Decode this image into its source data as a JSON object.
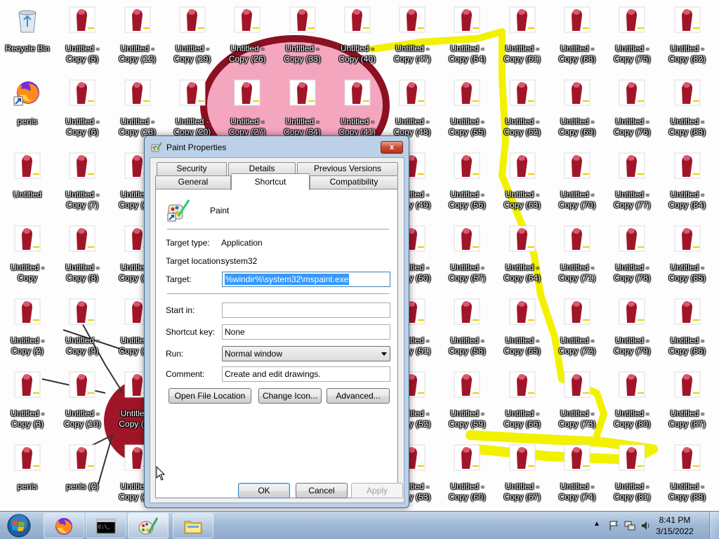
{
  "desktop": {
    "icons": [
      {
        "label": "Recycle Bin",
        "kind": "recycle"
      },
      {
        "label": "Untitled - Copy (5)",
        "kind": "paint"
      },
      {
        "label": "Untitled - Copy (12)",
        "kind": "paint"
      },
      {
        "label": "Untitled - Copy (19)",
        "kind": "paint"
      },
      {
        "label": "Untitled - Copy (26)",
        "kind": "paint"
      },
      {
        "label": "Untitled - Copy (33)",
        "kind": "paint"
      },
      {
        "label": "Untitled - Copy (40)",
        "kind": "paint"
      },
      {
        "label": "Untitled - Copy (47)",
        "kind": "paint"
      },
      {
        "label": "Untitled - Copy (54)",
        "kind": "paint"
      },
      {
        "label": "Untitled - Copy (61)",
        "kind": "paint"
      },
      {
        "label": "Untitled - Copy (68)",
        "kind": "paint"
      },
      {
        "label": "Untitled - Copy (75)",
        "kind": "paint"
      },
      {
        "label": "Untitled - Copy (82)",
        "kind": "paint"
      },
      {
        "label": "penis",
        "kind": "firefox-shortcut"
      },
      {
        "label": "Untitled - Copy (6)",
        "kind": "paint"
      },
      {
        "label": "Untitled - Copy (13)",
        "kind": "paint"
      },
      {
        "label": "Untitled - Copy (20)",
        "kind": "paint"
      },
      {
        "label": "Untitled - Copy (27)",
        "kind": "paint"
      },
      {
        "label": "Untitled - Copy (34)",
        "kind": "paint"
      },
      {
        "label": "Untitled - Copy (41)",
        "kind": "paint"
      },
      {
        "label": "Untitled - Copy (48)",
        "kind": "paint"
      },
      {
        "label": "Untitled - Copy (55)",
        "kind": "paint"
      },
      {
        "label": "Untitled - Copy (62)",
        "kind": "paint"
      },
      {
        "label": "Untitled - Copy (69)",
        "kind": "paint"
      },
      {
        "label": "Untitled - Copy (76)",
        "kind": "paint"
      },
      {
        "label": "Untitled - Copy (83)",
        "kind": "paint"
      },
      {
        "label": "Untitled",
        "kind": "paint"
      },
      {
        "label": "Untitled - Copy (7)",
        "kind": "paint"
      },
      {
        "label": "Untitled - Copy (14)",
        "kind": "paint"
      },
      {
        "label": "",
        "kind": "hidden"
      },
      {
        "label": "",
        "kind": "hidden"
      },
      {
        "label": "",
        "kind": "hidden"
      },
      {
        "label": "",
        "kind": "hidden"
      },
      {
        "label": "Untitled - Copy (49)",
        "kind": "paint"
      },
      {
        "label": "Untitled - Copy (56)",
        "kind": "paint"
      },
      {
        "label": "Untitled - Copy (63)",
        "kind": "paint"
      },
      {
        "label": "Untitled - Copy (70)",
        "kind": "paint"
      },
      {
        "label": "Untitled - Copy (77)",
        "kind": "paint"
      },
      {
        "label": "Untitled - Copy (84)",
        "kind": "paint"
      },
      {
        "label": "Untitled - Copy",
        "kind": "paint"
      },
      {
        "label": "Untitled - Copy (8)",
        "kind": "paint"
      },
      {
        "label": "Untitled - Copy (15)",
        "kind": "paint"
      },
      {
        "label": "",
        "kind": "hidden"
      },
      {
        "label": "",
        "kind": "hidden"
      },
      {
        "label": "",
        "kind": "hidden"
      },
      {
        "label": "",
        "kind": "hidden"
      },
      {
        "label": "Untitled - Copy (50)",
        "kind": "paint"
      },
      {
        "label": "Untitled - Copy (57)",
        "kind": "paint"
      },
      {
        "label": "Untitled - Copy (64)",
        "kind": "paint"
      },
      {
        "label": "Untitled - Copy (71)",
        "kind": "paint"
      },
      {
        "label": "Untitled - Copy (78)",
        "kind": "paint"
      },
      {
        "label": "Untitled - Copy (85)",
        "kind": "paint"
      },
      {
        "label": "Untitled - Copy (2)",
        "kind": "paint"
      },
      {
        "label": "Untitled - Copy (9)",
        "kind": "paint"
      },
      {
        "label": "Untitled - Copy (16)",
        "kind": "paint"
      },
      {
        "label": "",
        "kind": "hidden"
      },
      {
        "label": "",
        "kind": "hidden"
      },
      {
        "label": "",
        "kind": "hidden"
      },
      {
        "label": "",
        "kind": "hidden"
      },
      {
        "label": "Untitled - Copy (51)",
        "kind": "paint"
      },
      {
        "label": "Untitled - Copy (58)",
        "kind": "paint"
      },
      {
        "label": "Untitled - Copy (65)",
        "kind": "paint"
      },
      {
        "label": "Untitled - Copy (72)",
        "kind": "paint"
      },
      {
        "label": "Untitled - Copy (79)",
        "kind": "paint"
      },
      {
        "label": "Untitled - Copy (86)",
        "kind": "paint"
      },
      {
        "label": "Untitled - Copy (3)",
        "kind": "paint"
      },
      {
        "label": "Untitled - Copy (10)",
        "kind": "paint"
      },
      {
        "label": "Untitled - Copy (17)",
        "kind": "paint"
      },
      {
        "label": "",
        "kind": "hidden"
      },
      {
        "label": "",
        "kind": "hidden"
      },
      {
        "label": "",
        "kind": "hidden"
      },
      {
        "label": "",
        "kind": "hidden"
      },
      {
        "label": "Untitled - Copy (52)",
        "kind": "paint"
      },
      {
        "label": "Untitled - Copy (59)",
        "kind": "paint"
      },
      {
        "label": "Untitled - Copy (66)",
        "kind": "paint"
      },
      {
        "label": "Untitled - Copy (73)",
        "kind": "paint"
      },
      {
        "label": "Untitled - Copy (80)",
        "kind": "paint"
      },
      {
        "label": "Untitled - Copy (87)",
        "kind": "paint"
      },
      {
        "label": "penis",
        "kind": "paint"
      },
      {
        "label": "penis (2)",
        "kind": "paint"
      },
      {
        "label": "Untitled - Copy (18)",
        "kind": "paint"
      },
      {
        "label": "",
        "kind": "hidden"
      },
      {
        "label": "",
        "kind": "hidden"
      },
      {
        "label": "",
        "kind": "hidden"
      },
      {
        "label": "",
        "kind": "hidden"
      },
      {
        "label": "Untitled - Copy (53)",
        "kind": "paint"
      },
      {
        "label": "Untitled - Copy (60)",
        "kind": "paint"
      },
      {
        "label": "Untitled - Copy (67)",
        "kind": "paint"
      },
      {
        "label": "Untitled - Copy (74)",
        "kind": "paint"
      },
      {
        "label": "Untitled - Copy (81)",
        "kind": "paint"
      },
      {
        "label": "Untitled - Copy (88)",
        "kind": "paint"
      }
    ]
  },
  "dialog": {
    "title": "Paint Properties",
    "close_label": "x",
    "tabs_back": [
      "Security",
      "Details",
      "Previous Versions"
    ],
    "tabs_front": [
      "General",
      "Shortcut",
      "Compatibility"
    ],
    "active_tab": "Shortcut",
    "app_name": "Paint",
    "target_type_label": "Target type:",
    "target_type_value": "Application",
    "target_location_label": "Target location:",
    "target_location_value": "system32",
    "target_label": "Target:",
    "target_value": "%windir%\\system32\\mspaint.exe",
    "start_in_label": "Start in:",
    "start_in_value": "",
    "shortcut_key_label": "Shortcut key:",
    "shortcut_key_value": "None",
    "run_label": "Run:",
    "run_value": "Normal window",
    "comment_label": "Comment:",
    "comment_value": "Create and edit drawings.",
    "open_file_location": "Open File Location",
    "change_icon": "Change Icon...",
    "advanced": "Advanced...",
    "ok": "OK",
    "cancel": "Cancel",
    "apply": "Apply"
  },
  "taskbar": {
    "start_icon": "windows-orb-icon",
    "pinned": [
      "firefox-icon",
      "cmd-icon",
      "paint-icon",
      "explorer-icon"
    ],
    "clock_time": "8:41 PM",
    "clock_date": "3/15/2022"
  },
  "colors": {
    "drawing_red": "#a01628",
    "drawing_pink": "#f4a6bf",
    "drawing_yellow": "#f2f200",
    "selection_blue": "#3399ff"
  }
}
